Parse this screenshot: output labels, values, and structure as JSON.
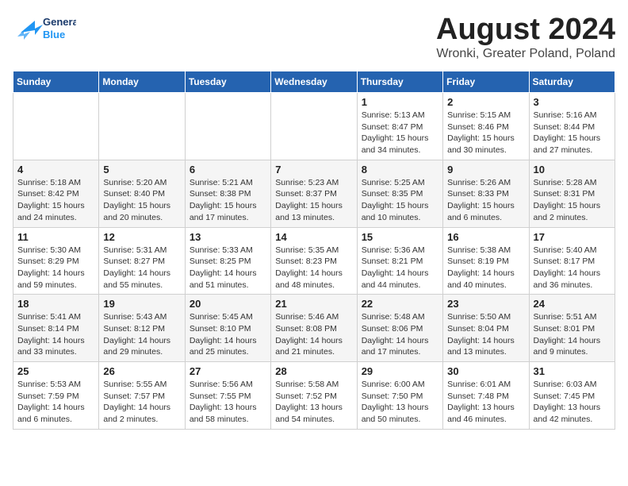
{
  "logo": {
    "line1": "General",
    "line2": "Blue"
  },
  "title": "August 2024",
  "subtitle": "Wronki, Greater Poland, Poland",
  "days_of_week": [
    "Sunday",
    "Monday",
    "Tuesday",
    "Wednesday",
    "Thursday",
    "Friday",
    "Saturday"
  ],
  "weeks": [
    [
      {
        "day": "",
        "info": ""
      },
      {
        "day": "",
        "info": ""
      },
      {
        "day": "",
        "info": ""
      },
      {
        "day": "",
        "info": ""
      },
      {
        "day": "1",
        "info": "Sunrise: 5:13 AM\nSunset: 8:47 PM\nDaylight: 15 hours\nand 34 minutes."
      },
      {
        "day": "2",
        "info": "Sunrise: 5:15 AM\nSunset: 8:46 PM\nDaylight: 15 hours\nand 30 minutes."
      },
      {
        "day": "3",
        "info": "Sunrise: 5:16 AM\nSunset: 8:44 PM\nDaylight: 15 hours\nand 27 minutes."
      }
    ],
    [
      {
        "day": "4",
        "info": "Sunrise: 5:18 AM\nSunset: 8:42 PM\nDaylight: 15 hours\nand 24 minutes."
      },
      {
        "day": "5",
        "info": "Sunrise: 5:20 AM\nSunset: 8:40 PM\nDaylight: 15 hours\nand 20 minutes."
      },
      {
        "day": "6",
        "info": "Sunrise: 5:21 AM\nSunset: 8:38 PM\nDaylight: 15 hours\nand 17 minutes."
      },
      {
        "day": "7",
        "info": "Sunrise: 5:23 AM\nSunset: 8:37 PM\nDaylight: 15 hours\nand 13 minutes."
      },
      {
        "day": "8",
        "info": "Sunrise: 5:25 AM\nSunset: 8:35 PM\nDaylight: 15 hours\nand 10 minutes."
      },
      {
        "day": "9",
        "info": "Sunrise: 5:26 AM\nSunset: 8:33 PM\nDaylight: 15 hours\nand 6 minutes."
      },
      {
        "day": "10",
        "info": "Sunrise: 5:28 AM\nSunset: 8:31 PM\nDaylight: 15 hours\nand 2 minutes."
      }
    ],
    [
      {
        "day": "11",
        "info": "Sunrise: 5:30 AM\nSunset: 8:29 PM\nDaylight: 14 hours\nand 59 minutes."
      },
      {
        "day": "12",
        "info": "Sunrise: 5:31 AM\nSunset: 8:27 PM\nDaylight: 14 hours\nand 55 minutes."
      },
      {
        "day": "13",
        "info": "Sunrise: 5:33 AM\nSunset: 8:25 PM\nDaylight: 14 hours\nand 51 minutes."
      },
      {
        "day": "14",
        "info": "Sunrise: 5:35 AM\nSunset: 8:23 PM\nDaylight: 14 hours\nand 48 minutes."
      },
      {
        "day": "15",
        "info": "Sunrise: 5:36 AM\nSunset: 8:21 PM\nDaylight: 14 hours\nand 44 minutes."
      },
      {
        "day": "16",
        "info": "Sunrise: 5:38 AM\nSunset: 8:19 PM\nDaylight: 14 hours\nand 40 minutes."
      },
      {
        "day": "17",
        "info": "Sunrise: 5:40 AM\nSunset: 8:17 PM\nDaylight: 14 hours\nand 36 minutes."
      }
    ],
    [
      {
        "day": "18",
        "info": "Sunrise: 5:41 AM\nSunset: 8:14 PM\nDaylight: 14 hours\nand 33 minutes."
      },
      {
        "day": "19",
        "info": "Sunrise: 5:43 AM\nSunset: 8:12 PM\nDaylight: 14 hours\nand 29 minutes."
      },
      {
        "day": "20",
        "info": "Sunrise: 5:45 AM\nSunset: 8:10 PM\nDaylight: 14 hours\nand 25 minutes."
      },
      {
        "day": "21",
        "info": "Sunrise: 5:46 AM\nSunset: 8:08 PM\nDaylight: 14 hours\nand 21 minutes."
      },
      {
        "day": "22",
        "info": "Sunrise: 5:48 AM\nSunset: 8:06 PM\nDaylight: 14 hours\nand 17 minutes."
      },
      {
        "day": "23",
        "info": "Sunrise: 5:50 AM\nSunset: 8:04 PM\nDaylight: 14 hours\nand 13 minutes."
      },
      {
        "day": "24",
        "info": "Sunrise: 5:51 AM\nSunset: 8:01 PM\nDaylight: 14 hours\nand 9 minutes."
      }
    ],
    [
      {
        "day": "25",
        "info": "Sunrise: 5:53 AM\nSunset: 7:59 PM\nDaylight: 14 hours\nand 6 minutes."
      },
      {
        "day": "26",
        "info": "Sunrise: 5:55 AM\nSunset: 7:57 PM\nDaylight: 14 hours\nand 2 minutes."
      },
      {
        "day": "27",
        "info": "Sunrise: 5:56 AM\nSunset: 7:55 PM\nDaylight: 13 hours\nand 58 minutes."
      },
      {
        "day": "28",
        "info": "Sunrise: 5:58 AM\nSunset: 7:52 PM\nDaylight: 13 hours\nand 54 minutes."
      },
      {
        "day": "29",
        "info": "Sunrise: 6:00 AM\nSunset: 7:50 PM\nDaylight: 13 hours\nand 50 minutes."
      },
      {
        "day": "30",
        "info": "Sunrise: 6:01 AM\nSunset: 7:48 PM\nDaylight: 13 hours\nand 46 minutes."
      },
      {
        "day": "31",
        "info": "Sunrise: 6:03 AM\nSunset: 7:45 PM\nDaylight: 13 hours\nand 42 minutes."
      }
    ]
  ]
}
